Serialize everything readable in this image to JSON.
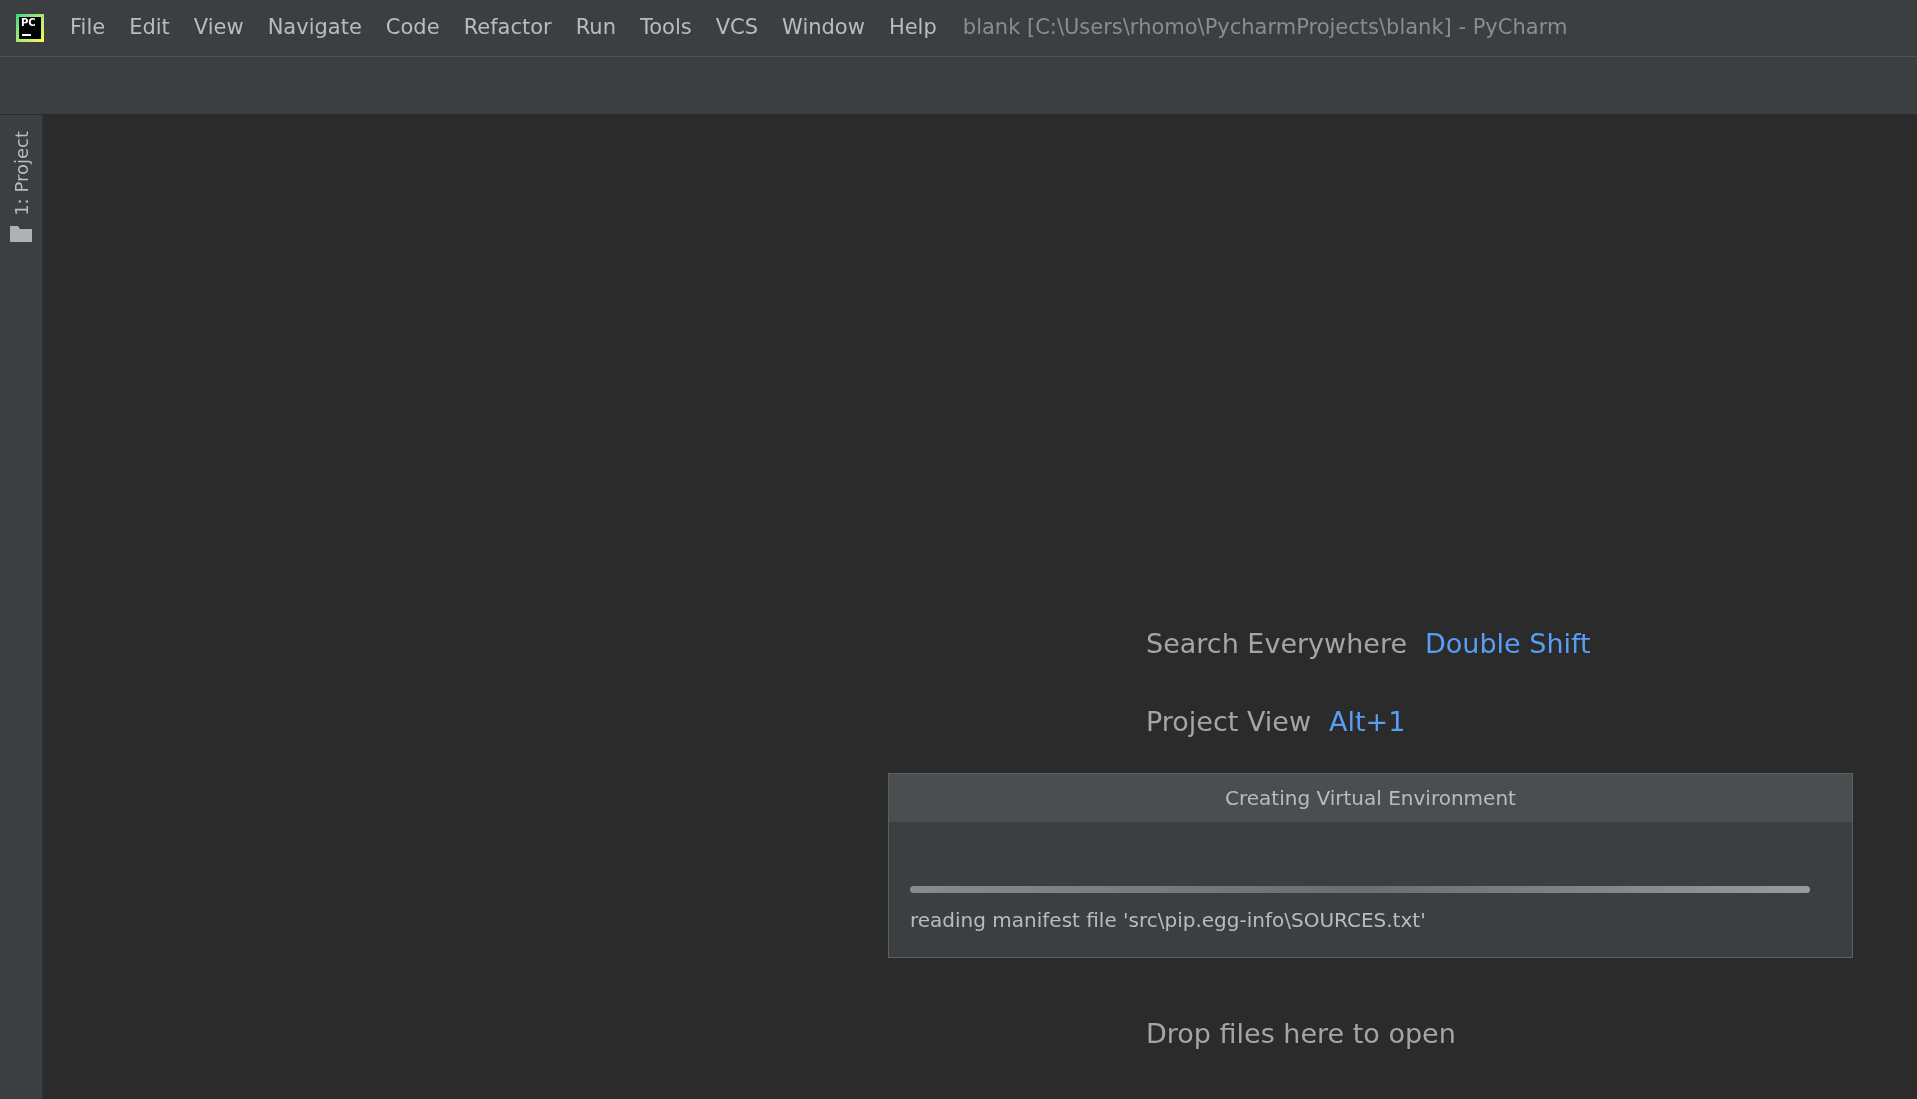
{
  "window": {
    "title": "blank [C:\\Users\\rhomo\\PycharmProjects\\blank] - PyCharm"
  },
  "logo_text": "PC",
  "menu": [
    "File",
    "Edit",
    "View",
    "Navigate",
    "Code",
    "Refactor",
    "Run",
    "Tools",
    "VCS",
    "Window",
    "Help"
  ],
  "sidebar": {
    "tool_window": "1: Project"
  },
  "hints": [
    {
      "label": "Search Everywhere",
      "shortcut": "Double Shift"
    },
    {
      "label": "Project View",
      "shortcut": "Alt+1"
    }
  ],
  "drop_hint": "Drop files here to open",
  "dialog": {
    "title": "Creating Virtual Environment",
    "indeterminate": true,
    "status": "reading manifest file 'src\\pip.egg-info\\SOURCES.txt'"
  }
}
